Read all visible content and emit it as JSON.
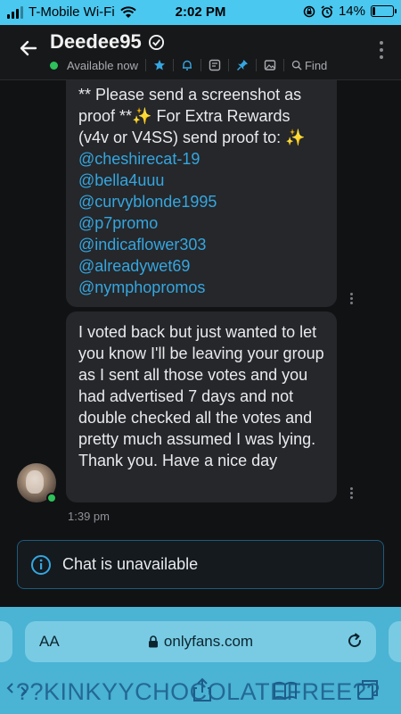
{
  "status_bar": {
    "carrier": "T-Mobile Wi-Fi",
    "time": "2:02 PM",
    "battery_pct": "14%",
    "battery_level": 0.14
  },
  "header": {
    "name": "Deedee95",
    "status": "Available now",
    "find_label": "Find"
  },
  "messages": [
    {
      "text": "** Please send a screenshot as proof **✨ For Extra Rewards (v4v or V4SS) send proof to: ✨",
      "mentions": [
        "@cheshirecat-19",
        "@bella4uuu",
        "@curvyblonde1995",
        "@p7promo",
        "@indicaflower303",
        "@alreadywet69",
        "@nymphopromos"
      ]
    },
    {
      "text": "I voted back but just wanted to let you know I'll be leaving your group as I sent all those votes and you had advertised 7 days and not double checked all the votes and pretty much assumed I was lying. Thank you. Have a nice day",
      "time": "1:39 pm"
    }
  ],
  "notice": {
    "text": "Chat is unavailable"
  },
  "browser": {
    "text_size_label": "AA",
    "url": "onlyfans.com"
  },
  "overlay_text": "??KINKYYCHOCOLATEFREE??",
  "colors": {
    "accent": "#35a6e0",
    "online": "#2ec25b",
    "status_bar": "#4ac8f0"
  }
}
